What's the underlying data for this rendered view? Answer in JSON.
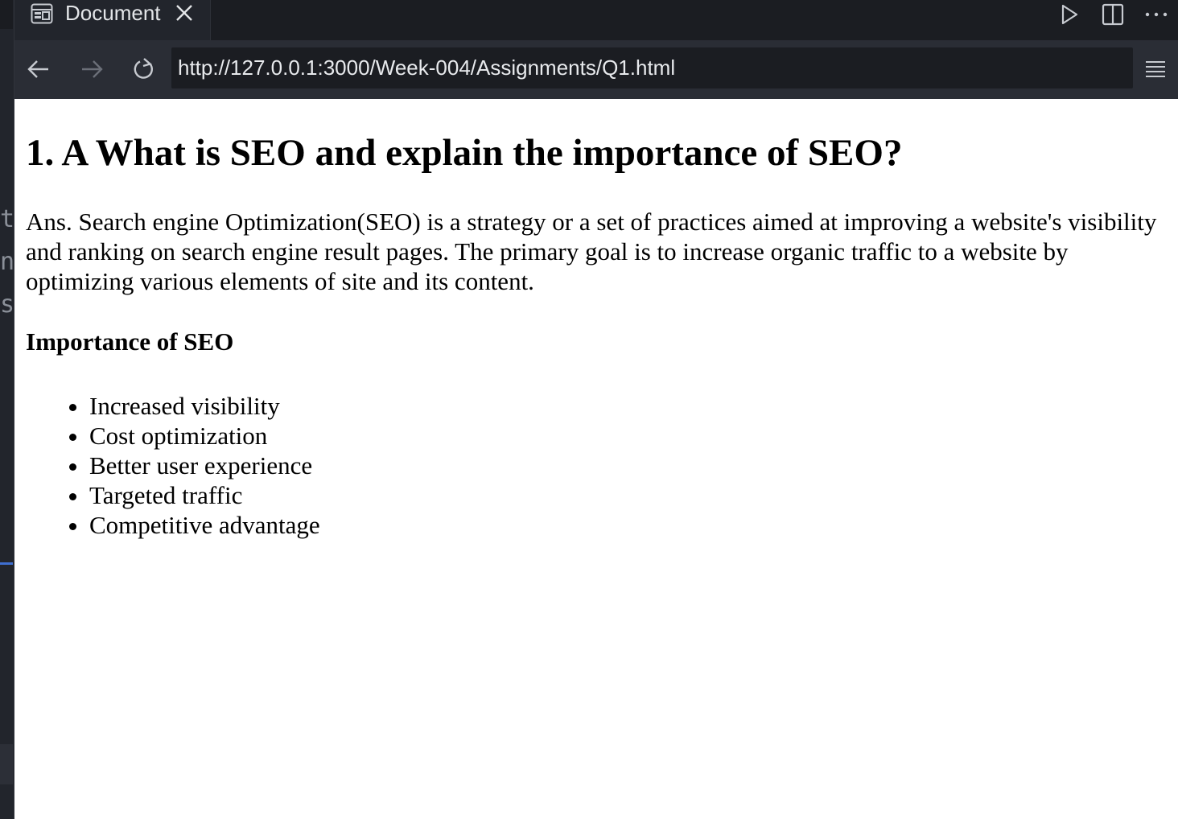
{
  "tab": {
    "title": "Document"
  },
  "address_bar": {
    "url": "http://127.0.0.1:3000/Week-004/Assignments/Q1.html"
  },
  "editor_strip": {
    "chars": [
      "t",
      "n",
      "s"
    ]
  },
  "page": {
    "heading": "1. A What is SEO and explain the importance of SEO?",
    "answer": "Ans. Search engine Optimization(SEO) is a strategy or a set of practices aimed at improving a website's visibility and ranking on search engine result pages. The primary goal is to increase organic traffic to a website by optimizing various elements of site and its content.",
    "subheading": "Importance of SEO",
    "list": [
      "Increased visibility",
      "Cost optimization",
      "Better user experience",
      "Targeted traffic",
      "Competitive advantage"
    ]
  },
  "icons": {
    "tab_preview": "browser-preview-icon",
    "tab_close": "close-icon",
    "run": "play-icon",
    "split": "split-editor-icon",
    "more": "more-actions-icon",
    "back": "arrow-left-icon",
    "forward": "arrow-right-icon",
    "reload": "reload-icon",
    "menu": "hamburger-menu-icon"
  },
  "colors": {
    "chrome_bg": "#1f2229",
    "tab_active": "#22252c",
    "address_bar_bg": "#2a2d35",
    "url_field_bg": "#1b1d22",
    "page_bg": "#ffffff",
    "accent": "#3f6fd1"
  }
}
